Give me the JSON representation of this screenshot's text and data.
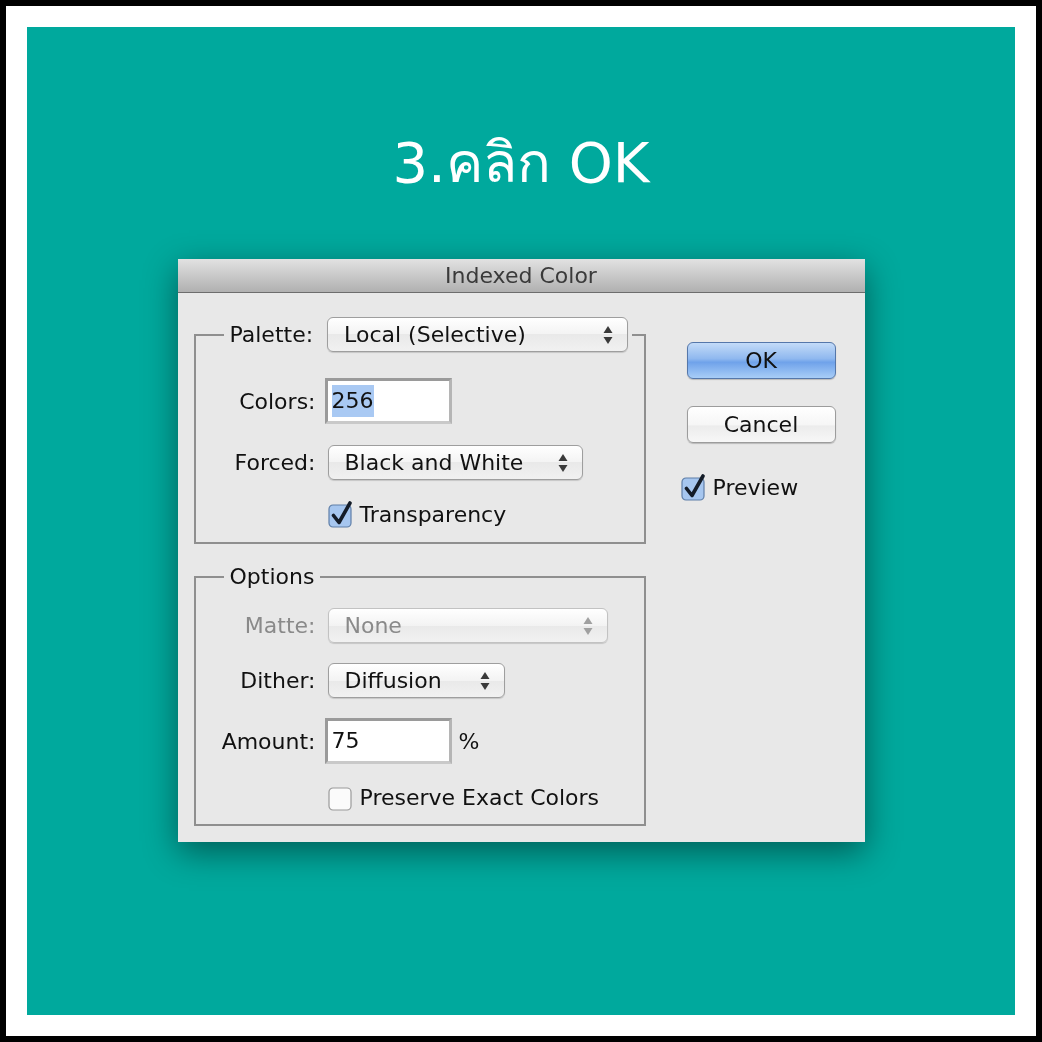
{
  "heading": "3.คลิก OK",
  "window": {
    "title": "Indexed Color"
  },
  "palette_group": {
    "palette": {
      "label": "Palette:",
      "value": "Local (Selective)",
      "disabled": false
    },
    "fields": [
      {
        "kind": "text",
        "label": "Colors:",
        "value": "256",
        "text_selected": true,
        "disabled": false
      },
      {
        "kind": "select",
        "label": "Forced:",
        "value": "Black and White",
        "disabled": false
      },
      {
        "kind": "checkbox",
        "label": "Transparency",
        "checked": true,
        "disabled": false
      }
    ]
  },
  "options_group": {
    "title": "Options",
    "fields": [
      {
        "kind": "select",
        "label": "Matte:",
        "value": "None",
        "disabled": true
      },
      {
        "kind": "select",
        "label": "Dither:",
        "value": "Diffusion",
        "disabled": false
      },
      {
        "kind": "text",
        "label": "Amount:",
        "value": "75",
        "unit": "%",
        "text_selected": false,
        "disabled": false
      },
      {
        "kind": "checkbox",
        "label": "Preserve Exact Colors",
        "checked": false,
        "disabled": false
      }
    ]
  },
  "buttons": [
    {
      "label": "OK",
      "default": true
    },
    {
      "label": "Cancel",
      "default": false
    }
  ],
  "preview": {
    "label": "Preview",
    "checked": true
  }
}
